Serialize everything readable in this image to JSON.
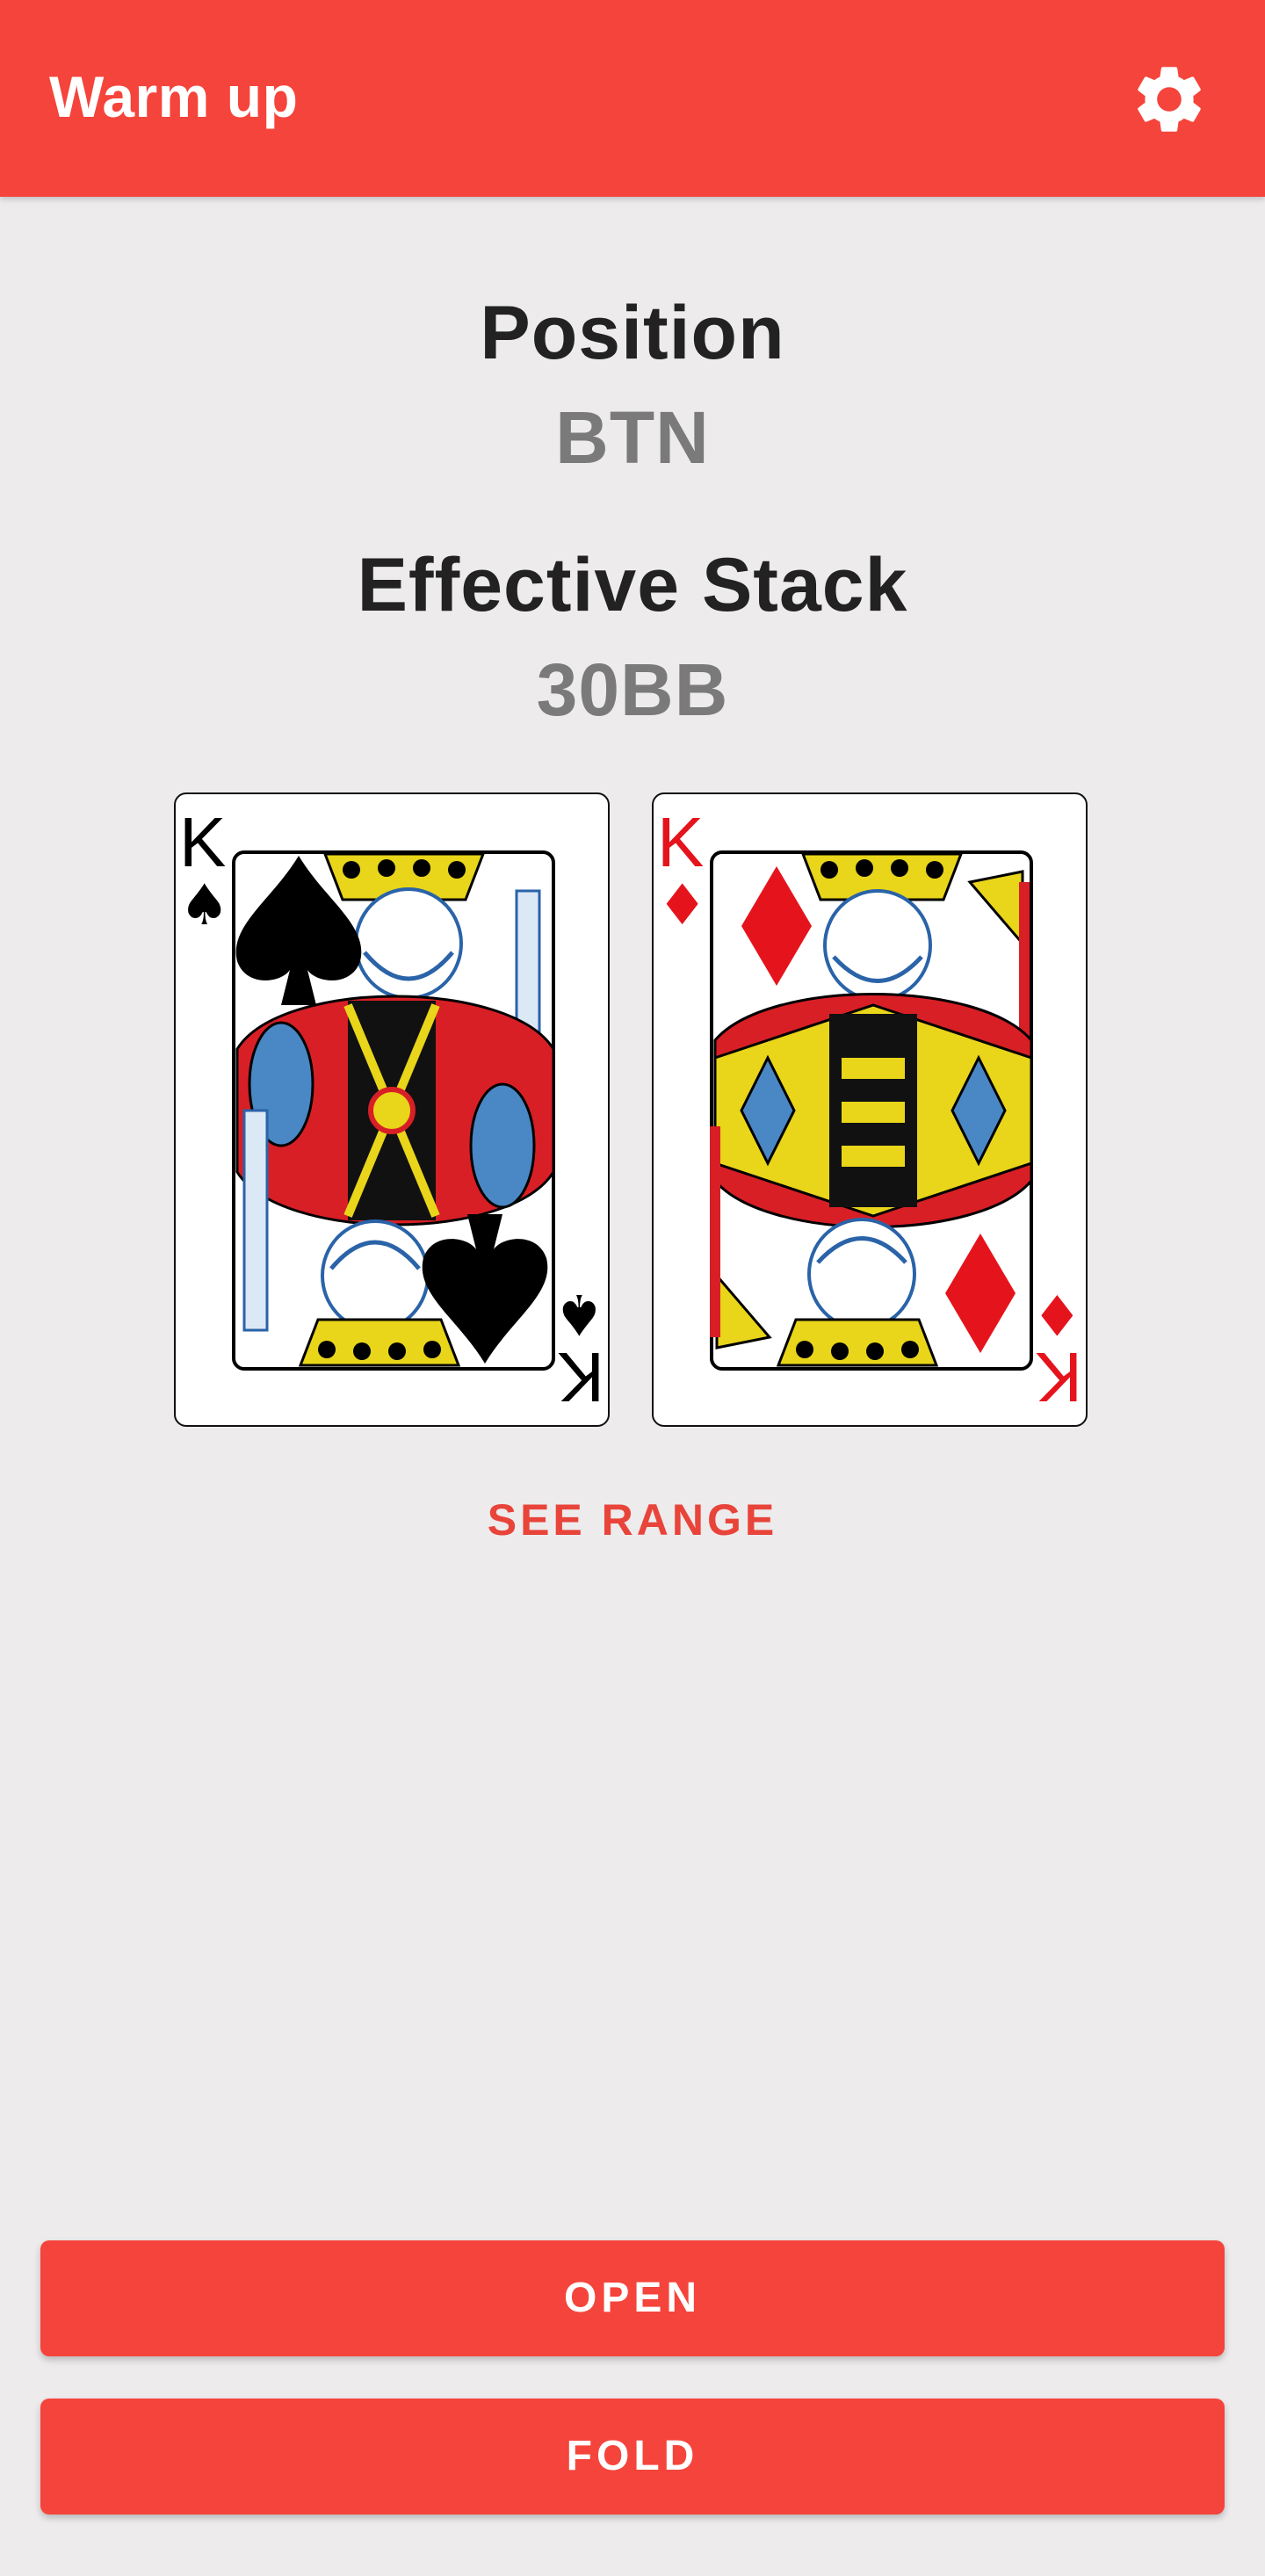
{
  "app_bar": {
    "title": "Warm up",
    "settings_icon": "gear-icon",
    "background_color": "#f5443b"
  },
  "position": {
    "label": "Position",
    "value": "BTN"
  },
  "stack": {
    "label": "Effective Stack",
    "value": "30BB"
  },
  "cards": [
    {
      "rank": "K",
      "suit": "spades",
      "suit_symbol": "♠",
      "color": "#000000"
    },
    {
      "rank": "K",
      "suit": "diamonds",
      "suit_symbol": "♦",
      "color": "#e5141c"
    }
  ],
  "actions": {
    "see_range": "SEE RANGE",
    "open": "OPEN",
    "fold": "FOLD"
  }
}
